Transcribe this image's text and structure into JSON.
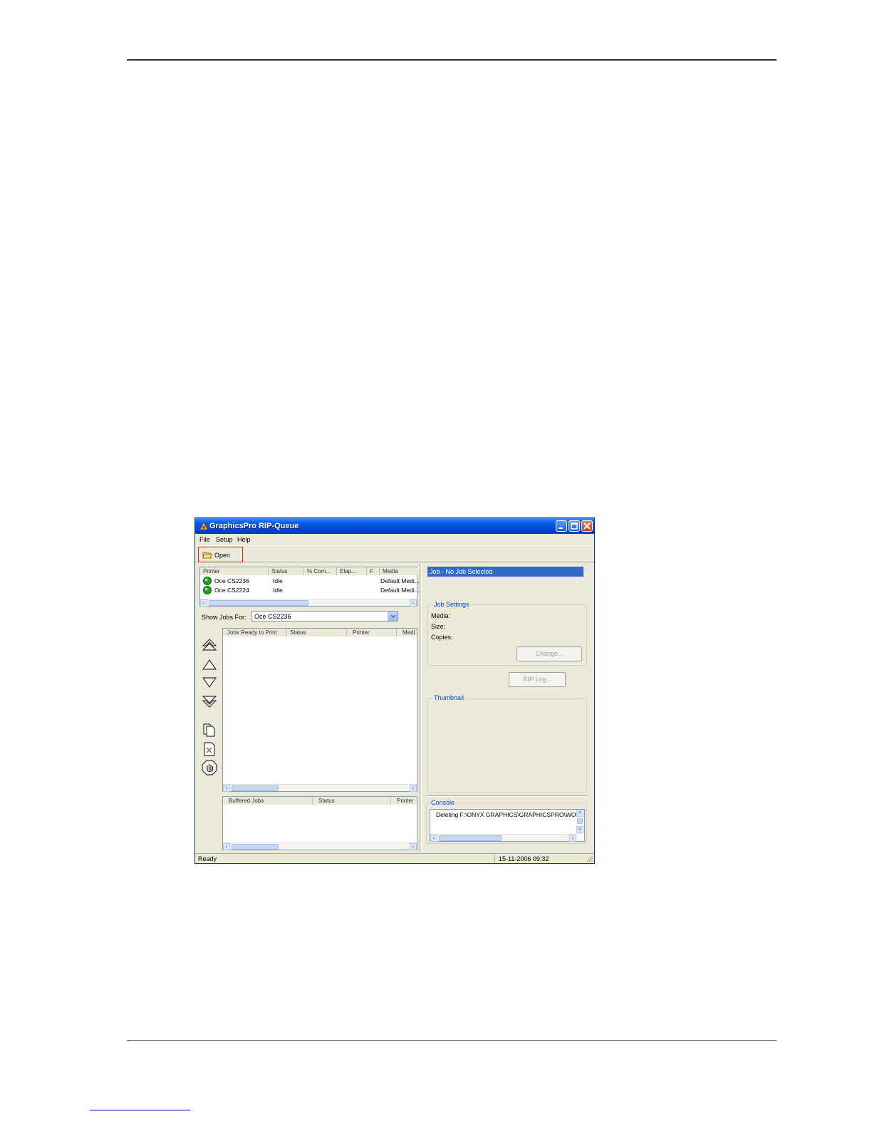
{
  "window": {
    "title": "GraphicsPro RIP-Queue",
    "menu": [
      "File",
      "Setup",
      "Help"
    ],
    "toolbar": {
      "open_label": "Open"
    }
  },
  "printers": {
    "headers": [
      "Printer",
      "Status",
      "% Com...",
      "Elap...",
      "F",
      "Media"
    ],
    "rows": [
      {
        "name": "Oce CS2236",
        "status": "Idle",
        "media": "Default Medi..."
      },
      {
        "name": "Oce CS2224",
        "status": "Idle",
        "media": "Default Medi..."
      }
    ]
  },
  "show_jobs": {
    "label": "Show Jobs For:",
    "value": "Oce CS2236"
  },
  "jobs_ready": {
    "headers": [
      "Jobs Ready to Print",
      "Status",
      "Printer",
      "Medi"
    ]
  },
  "buffered_jobs": {
    "headers": [
      "Buffered Jobs",
      "Status",
      "Printer"
    ]
  },
  "job_panel": {
    "header": "Job - No Job Selected",
    "settings_title": "Job Settings",
    "media_label": "Media:",
    "size_label": "Size:",
    "copies_label": "Copies:",
    "change_button": "Change...",
    "rip_log_button": "RIP Log...",
    "thumbnail_title": "Thumbnail"
  },
  "console": {
    "title": "Console",
    "text": "Deleting F:\\ONYX GRAPHICS\\GRAPHICSPRO\\WORK"
  },
  "statusbar": {
    "status": "Ready",
    "datetime": "15-11-2006  09:32"
  },
  "colors": {
    "title_blue": "#0046d5",
    "selection_blue": "#316ac5",
    "highlight_red": "#e82020",
    "idle_green": "#22a022"
  }
}
